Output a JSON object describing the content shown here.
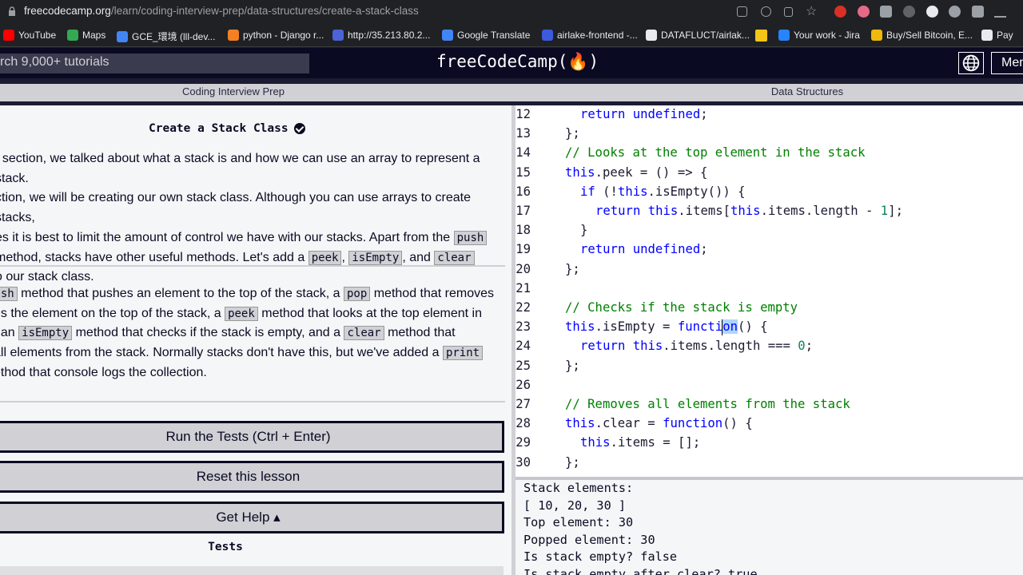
{
  "browser": {
    "url_host": "freecodecamp.org",
    "url_path": "/learn/coding-interview-prep/data-structures/create-a-stack-class",
    "bookmarks": [
      {
        "label": "YouTube",
        "color": "#ff0000"
      },
      {
        "label": "Maps",
        "color": "#34a853"
      },
      {
        "label": "GCE_環境 (lll-dev...",
        "color": "#4285f4"
      },
      {
        "label": "python - Django r...",
        "color": "#f48024"
      },
      {
        "label": "http://35.213.80.2...",
        "color": "#4b63d6"
      },
      {
        "label": "Google Translate",
        "color": "#4285f4"
      },
      {
        "label": "airlake-frontend -...",
        "color": "#3b5bdb"
      },
      {
        "label": "DATAFLUCT/airlak...",
        "color": "#e8eaed"
      },
      {
        "label": "Your work - Jira",
        "color": "#2684ff"
      },
      {
        "label": "Buy/Sell Bitcoin, E...",
        "color": "#f0b90b"
      },
      {
        "label": "Pay",
        "color": "#e8eaed"
      }
    ]
  },
  "nav": {
    "search_text": "rch 9,000+ tutorials",
    "logo": "freeCodeCamp(🔥)",
    "menu_label": "Men"
  },
  "breadcrumb": {
    "left": "Coding Interview Prep",
    "right": "Data Structures"
  },
  "lesson": {
    "title": "Create a Stack Class",
    "p1_lines": [
      "t section, we talked about what a stack is and how we can use an array to represent a stack.",
      "ction, we will be creating our own stack class. Although you can use arrays to create stacks,",
      "es it is best to limit the amount of control we have with our stacks. Apart from the ",
      " method, stacks have other useful methods. Let's add a ",
      "o our stack class."
    ],
    "codes": {
      "push": "push",
      "peek": "peek",
      "isEmpty": "isEmpty",
      "clear": "clear",
      "pop": "pop",
      "print": "print",
      "push_cut": "push"
    },
    "p1_and": ", and ",
    "p1_comma": ", ",
    "p2_lines": {
      "l1a": " method that pushes an element to the top of the stack, a ",
      "l1b": " method that removes",
      "l2a": "ns the element on the top of the stack, a ",
      "l2b": " method that looks at the top element in",
      "l3a": ", an ",
      "l3b": " method that checks if the stack is empty, and a ",
      "l3c": " method that",
      "l4a": "all elements from the stack. Normally stacks don't have this, but we've added a ",
      "l5": "ethod that console logs the collection."
    }
  },
  "buttons": {
    "run": "Run the Tests (Ctrl + Enter)",
    "reset": "Reset this lesson",
    "help": "Get Help ▴"
  },
  "tests_heading": "Tests",
  "editor": {
    "lines": [
      {
        "n": "12",
        "i": 1,
        "t": "return undefined;"
      },
      {
        "n": "13",
        "i": 0,
        "t": "};"
      },
      {
        "n": "14",
        "i": 0,
        "t": "// Looks at the top element in the stack"
      },
      {
        "n": "15",
        "i": 0,
        "t": "this.peek = () => {"
      },
      {
        "n": "16",
        "i": 1,
        "t": "if (!this.isEmpty()) {"
      },
      {
        "n": "17",
        "i": 2,
        "t": "return this.items[this.items.length - 1];"
      },
      {
        "n": "18",
        "i": 1,
        "t": "}"
      },
      {
        "n": "19",
        "i": 1,
        "t": "return undefined;"
      },
      {
        "n": "20",
        "i": 0,
        "t": "};"
      },
      {
        "n": "21",
        "i": 0,
        "t": ""
      },
      {
        "n": "22",
        "i": 0,
        "t": "// Checks if the stack is empty"
      },
      {
        "n": "23",
        "i": 0,
        "t": "this.isEmpty = function() {"
      },
      {
        "n": "24",
        "i": 1,
        "t": "return this.items.length === 0;"
      },
      {
        "n": "25",
        "i": 0,
        "t": "};"
      },
      {
        "n": "26",
        "i": 0,
        "t": ""
      },
      {
        "n": "27",
        "i": 0,
        "t": "// Removes all elements from the stack"
      },
      {
        "n": "28",
        "i": 0,
        "t": "this.clear = function() {"
      },
      {
        "n": "29",
        "i": 1,
        "t": "this.items = [];"
      },
      {
        "n": "30",
        "i": 0,
        "t": "};"
      }
    ]
  },
  "console": {
    "lines": [
      "Stack elements:",
      "[ 10, 20, 30 ]",
      "Top element: 30",
      "Popped element: 30",
      "Is stack empty? false",
      "Is stack empty after clear? true"
    ]
  }
}
